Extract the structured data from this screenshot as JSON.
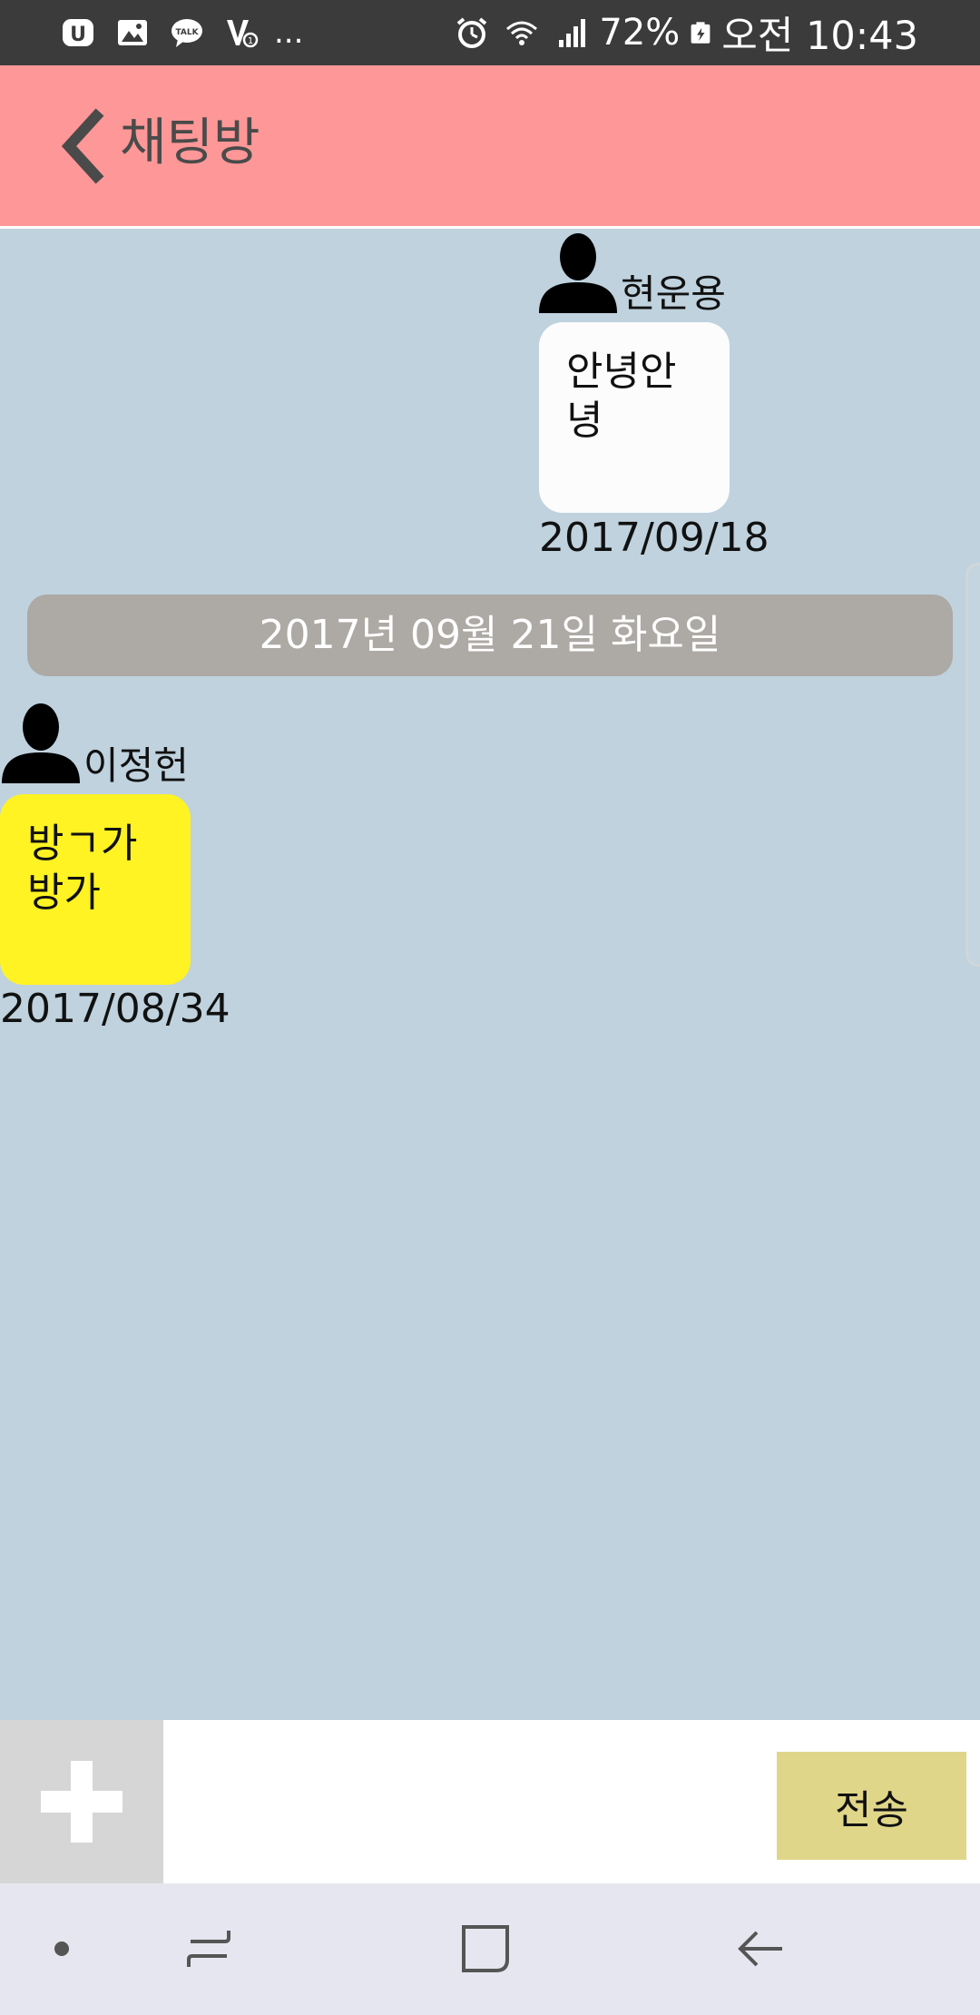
{
  "status_bar": {
    "battery": "72%",
    "time": "오전 10:43",
    "more": "...",
    "left_icons": [
      "u-plus-icon",
      "gallery-icon",
      "kakaotalk-icon",
      "volte-icon"
    ],
    "right_icons": [
      "alarm-icon",
      "wifi-icon",
      "signal-icon",
      "battery-icon"
    ]
  },
  "header": {
    "title": "채팅방",
    "background": "#fe9797"
  },
  "messages": [
    {
      "sender": "현운용",
      "text": "안녕안\n녕",
      "date": "2017/09/18",
      "bubble_color": "#fcfcfc"
    },
    {
      "sender": "이정헌",
      "text": "방ㄱ가\n방가",
      "date": "2017/08/34",
      "bubble_color": "#fff323"
    }
  ],
  "date_divider": "2017년 09월 21일 화요일",
  "input_bar": {
    "message_value": "",
    "send_label": "전송"
  },
  "colors": {
    "chat_background": "#bfd2de",
    "date_divider": "#ada9a4",
    "send_button": "#e0d689"
  }
}
